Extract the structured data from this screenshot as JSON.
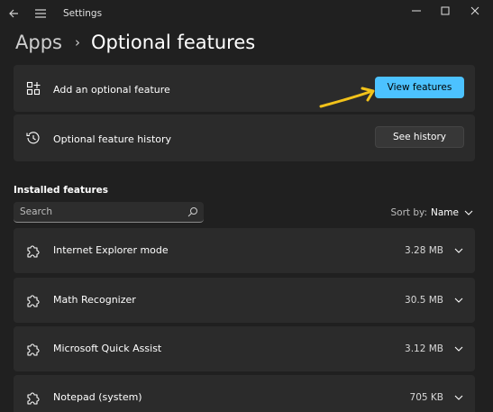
{
  "titlebar": {
    "app_title": "Settings",
    "back_icon": "back-arrow-icon",
    "menu_icon": "hamburger-menu-icon",
    "minimize_icon": "minimize-icon",
    "maximize_icon": "maximize-icon",
    "close_icon": "close-icon"
  },
  "breadcrumb": {
    "parent": "Apps",
    "separator": "›",
    "current": "Optional features"
  },
  "add_feature": {
    "label": "Add an optional feature",
    "button": "View features",
    "icon": "add-feature-icon"
  },
  "history": {
    "label": "Optional feature history",
    "button": "See history",
    "icon": "history-icon"
  },
  "installed": {
    "title": "Installed features",
    "search_placeholder": "Search",
    "sort_label": "Sort by:",
    "sort_value": "Name",
    "items": [
      {
        "name": "Internet Explorer mode",
        "size": "3.28 MB"
      },
      {
        "name": "Math Recognizer",
        "size": "30.5 MB"
      },
      {
        "name": "Microsoft Quick Assist",
        "size": "3.12 MB"
      },
      {
        "name": "Notepad (system)",
        "size": "705 KB"
      }
    ]
  },
  "colors": {
    "background": "#202020",
    "card": "#2b2b2b",
    "accent": "#4cc2ff",
    "annotation_arrow": "#f2c21a"
  }
}
